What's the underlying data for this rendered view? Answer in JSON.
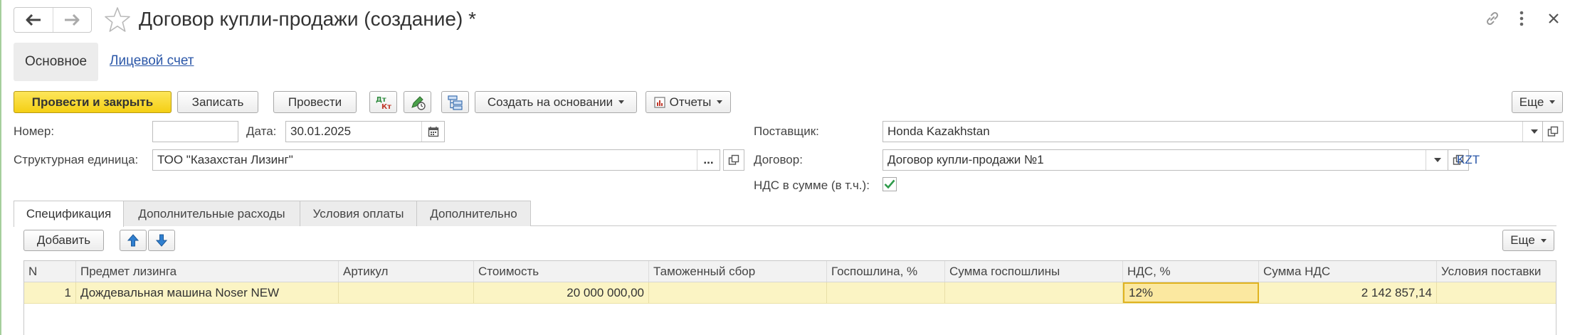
{
  "window": {
    "title": "Договор купли-продажи (создание) *"
  },
  "panel_tabs": {
    "main": "Основное",
    "account": "Лицевой счет"
  },
  "toolbar": {
    "post_close": "Провести и закрыть",
    "save": "Записать",
    "post": "Провести",
    "create_based": "Создать на основании",
    "reports": "Отчеты",
    "more": "Еще"
  },
  "form": {
    "number_label": "Номер:",
    "number_value": "",
    "date_label": "Дата:",
    "date_value": "30.01.2025",
    "unit_label": "Структурная единица:",
    "unit_value": "ТОО \"Казахстан Лизинг\"",
    "supplier_label": "Поставщик:",
    "supplier_value": "Honda Kazakhstan",
    "contract_label": "Договор:",
    "contract_value": "Договор купли-продажи №1",
    "currency": "KZT",
    "vat_label": "НДС в сумме (в т.ч.):",
    "vat_included": true,
    "ellipsis": "..."
  },
  "tabs": [
    {
      "label": "Спецификация",
      "active": true
    },
    {
      "label": "Дополнительные расходы",
      "active": false
    },
    {
      "label": "Условия оплаты",
      "active": false
    },
    {
      "label": "Дополнительно",
      "active": false
    }
  ],
  "table_toolbar": {
    "add": "Добавить",
    "more": "Еще"
  },
  "table": {
    "columns": [
      "N",
      "Предмет лизинга",
      "Артикул",
      "Стоимость",
      "Таможенный сбор",
      "Госпошлина, %",
      "Сумма госпошлины",
      "НДС, %",
      "Сумма НДС",
      "Условия поставки"
    ],
    "rows": [
      [
        "1",
        "Дождевальная машина Noser NEW",
        "",
        "20 000 000,00",
        "",
        "",
        "",
        "12%",
        "2 142 857,14",
        ""
      ]
    ]
  },
  "colors": {
    "primary_button": "#f4cf14",
    "selected_row": "#fbf4c4",
    "link": "#2b57a8",
    "check": "#2e9a4a"
  },
  "icons": [
    "back-arrow-icon",
    "forward-arrow-icon",
    "star-icon",
    "link-icon",
    "more-vert-icon",
    "close-icon",
    "dt-kt-icon",
    "edit-doc-icon",
    "structure-icon",
    "report-icon",
    "calendar-icon",
    "dropdown-icon",
    "open-icon",
    "up-arrow-icon",
    "down-arrow-icon",
    "checkbox-icon"
  ]
}
